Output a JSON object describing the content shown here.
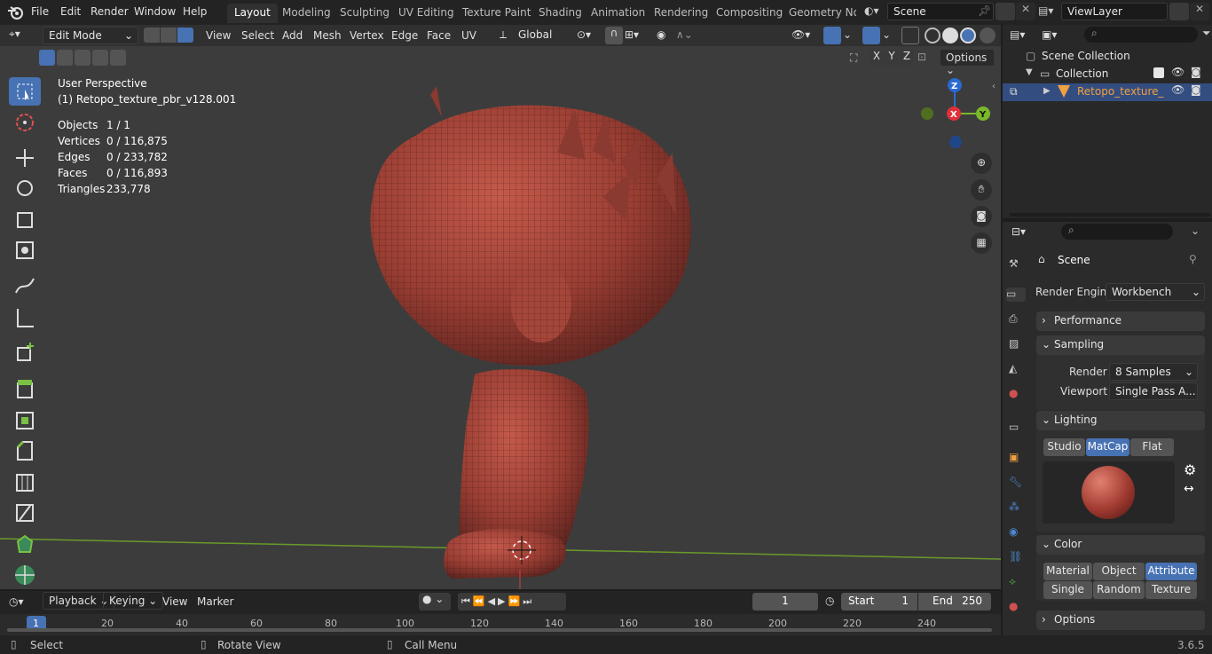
{
  "menu": {
    "file": "File",
    "edit": "Edit",
    "render": "Render",
    "window": "Window",
    "help": "Help"
  },
  "workspaces": [
    "Layout",
    "Modeling",
    "Sculpting",
    "UV Editing",
    "Texture Paint",
    "Shading",
    "Animation",
    "Rendering",
    "Compositing",
    "Geometry Noc"
  ],
  "scene": {
    "name": "Scene",
    "view_layer": "ViewLayer"
  },
  "vp_header": {
    "mode": "Edit Mode",
    "view": "View",
    "select": "Select",
    "add": "Add",
    "mesh": "Mesh",
    "vertex": "Vertex",
    "edge": "Edge",
    "face": "Face",
    "uv": "UV",
    "orientation": "Global",
    "options": "Options",
    "x": "X",
    "y": "Y",
    "z": "Z"
  },
  "overlay": {
    "perspective": "User Perspective",
    "object_name": "(1) Retopo_texture_pbr_v128.001",
    "stats": [
      {
        "label": "Objects",
        "value": "1 / 1"
      },
      {
        "label": "Vertices",
        "value": "0 / 116,875"
      },
      {
        "label": "Edges",
        "value": "0 / 233,782"
      },
      {
        "label": "Faces",
        "value": "0 / 116,893"
      },
      {
        "label": "Triangles",
        "value": "233,778"
      }
    ]
  },
  "gizmo": {
    "x": "X",
    "y": "Y",
    "z": "Z"
  },
  "outliner": {
    "root": "Scene Collection",
    "collection": "Collection",
    "object": "Retopo_texture_"
  },
  "properties": {
    "context": "Scene",
    "render_engine_label": "Render Engine",
    "render_engine": "Workbench",
    "performance": "Performance",
    "sampling": "Sampling",
    "render_label": "Render",
    "render_samples": "8 Samples",
    "viewport_label": "Viewport",
    "viewport_samples": "Single Pass A...",
    "lighting": "Lighting",
    "lighting_modes": [
      "Studio",
      "MatCap",
      "Flat"
    ],
    "color": "Color",
    "color_modes": [
      "Material",
      "Object",
      "Attribute",
      "Single",
      "Random",
      "Texture"
    ],
    "options": "Options"
  },
  "timeline": {
    "playback": "Playback",
    "keying": "Keying",
    "view": "View",
    "marker": "Marker",
    "current_frame": "1",
    "start_label": "Start",
    "start": "1",
    "end_label": "End",
    "end": "250",
    "ticks": [
      "1",
      "20",
      "40",
      "60",
      "80",
      "100",
      "120",
      "140",
      "160",
      "180",
      "200",
      "220",
      "240"
    ]
  },
  "statusbar": {
    "select": "Select",
    "rotate": "Rotate View",
    "call_menu": "Call Menu",
    "version": "3.6.5"
  },
  "colors": {
    "accent": "#4772b3",
    "mesh": "#a8463c",
    "grid_line": "#6a9a2a",
    "active_object": "#f0a040"
  }
}
